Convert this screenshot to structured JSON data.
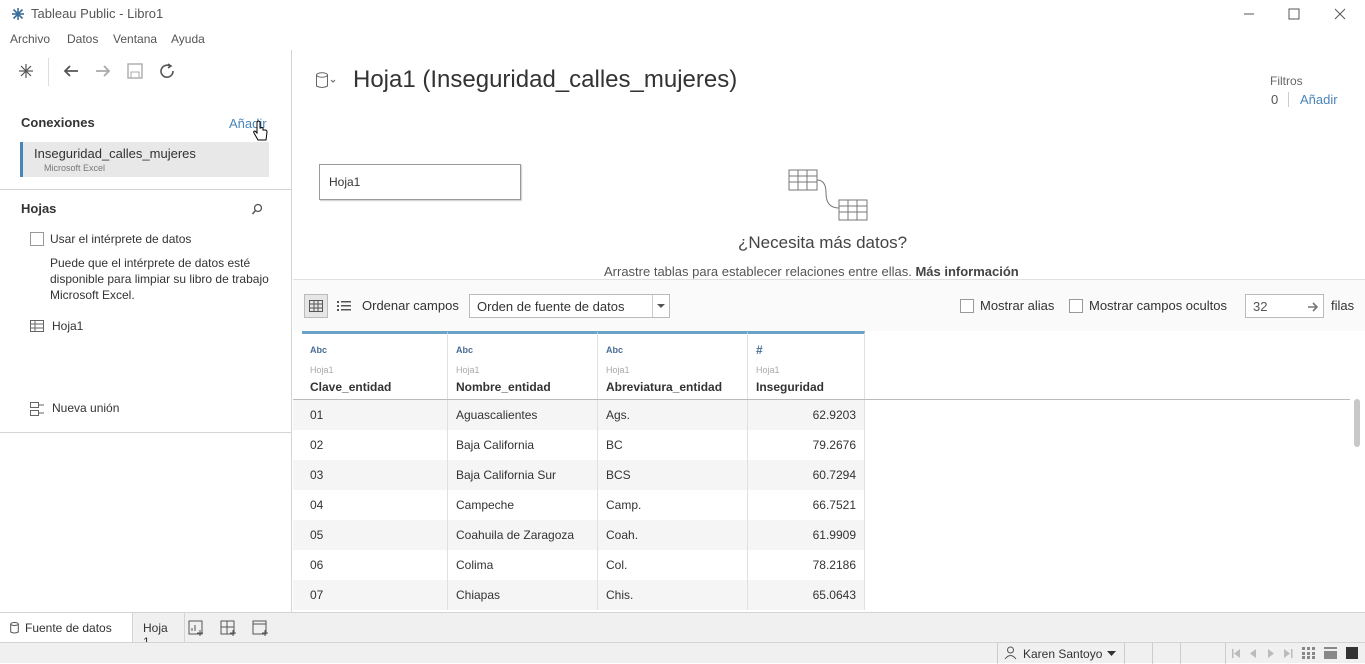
{
  "window": {
    "title": "Tableau Public - Libro1"
  },
  "menu": [
    "Archivo",
    "Datos",
    "Ventana",
    "Ayuda"
  ],
  "connections": {
    "title": "Conexiones",
    "add_label": "Añadir",
    "items": [
      {
        "name": "Inseguridad_calles_mujeres",
        "type": "Microsoft Excel"
      }
    ]
  },
  "sheets": {
    "title": "Hojas",
    "interpreter_label": "Usar el intérprete de datos",
    "interpreter_note": "Puede que el intérprete de datos esté disponible para limpiar su libro de trabajo Microsoft Excel.",
    "items": [
      "Hoja1"
    ],
    "new_union": "Nueva unión"
  },
  "canvas": {
    "title": "Hoja1 (Inseguridad_calles_mujeres)",
    "filters_label": "Filtros",
    "filters_count": "0",
    "filters_add": "Añadir",
    "table_box": "Hoja1",
    "need_more": "¿Necesita más datos?",
    "drag_hint": "Arrastre tablas para establecer relaciones entre ellas.",
    "more_info": "Más información"
  },
  "grid_toolbar": {
    "sort_label": "Ordenar campos",
    "sort_value": "Orden de fuente de datos",
    "show_alias": "Mostrar alias",
    "show_hidden": "Mostrar campos ocultos",
    "rows_value": "32",
    "rows_label": "filas"
  },
  "table": {
    "columns": [
      {
        "type": "Abc",
        "source": "Hoja1",
        "name": "Clave_entidad"
      },
      {
        "type": "Abc",
        "source": "Hoja1",
        "name": "Nombre_entidad"
      },
      {
        "type": "Abc",
        "source": "Hoja1",
        "name": "Abreviatura_entidad"
      },
      {
        "type": "#",
        "source": "Hoja1",
        "name": "Inseguridad"
      }
    ],
    "rows": [
      [
        "01",
        "Aguascalientes",
        "Ags.",
        "62.9203"
      ],
      [
        "02",
        "Baja California",
        "BC",
        "79.2676"
      ],
      [
        "03",
        "Baja California Sur",
        "BCS",
        "60.7294"
      ],
      [
        "04",
        "Campeche",
        "Camp.",
        "66.7521"
      ],
      [
        "05",
        "Coahuila de Zaragoza",
        "Coah.",
        "61.9909"
      ],
      [
        "06",
        "Colima",
        "Col.",
        "78.2186"
      ],
      [
        "07",
        "Chiapas",
        "Chis.",
        "65.0643"
      ]
    ]
  },
  "bottom_tabs": {
    "datasource": "Fuente de datos",
    "sheet": "Hoja 1"
  },
  "status": {
    "user": "Karen Santoyo"
  }
}
